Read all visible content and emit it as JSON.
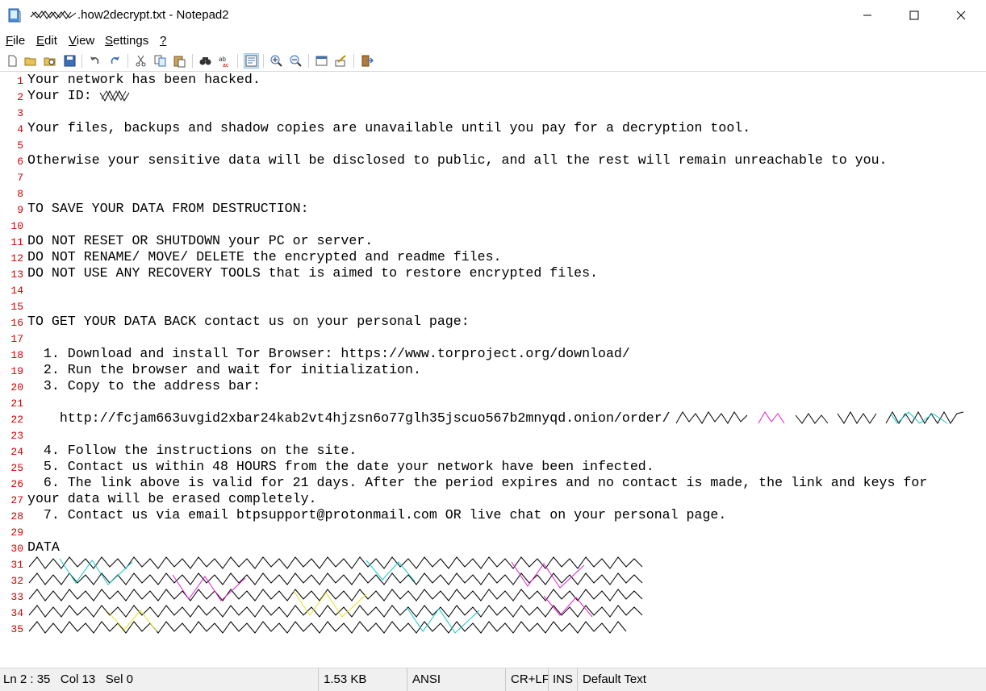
{
  "window": {
    "title": ".how2decrypt.txt - Notepad2",
    "minimize_label": "─",
    "maximize_label": "☐",
    "close_label": "✕"
  },
  "menu": [
    {
      "label": "File",
      "accel": "F",
      "rest": "ile"
    },
    {
      "label": "Edit",
      "accel": "E",
      "rest": "dit"
    },
    {
      "label": "View",
      "accel": "V",
      "rest": "iew"
    },
    {
      "label": "Settings",
      "accel": "S",
      "rest": "ettings"
    },
    {
      "label": "?",
      "accel": "?",
      "rest": ""
    }
  ],
  "toolbar": {
    "icons": [
      "new-file-icon",
      "open-folder-icon",
      "browse-icon",
      "save-icon",
      "undo-icon",
      "redo-icon",
      "cut-icon",
      "copy-icon",
      "paste-icon",
      "find-icon",
      "replace-icon",
      "word-wrap-icon",
      "zoom-in-icon",
      "zoom-out-icon",
      "select-scheme-icon",
      "customize-scheme-icon",
      "exit-icon"
    ],
    "pressed": "word-wrap-icon"
  },
  "document": {
    "line_numbers": [
      "1",
      "2",
      "3",
      "4",
      "5",
      "6",
      "7",
      "8",
      "9",
      "10",
      "11",
      "12",
      "13",
      "14",
      "15",
      "16",
      "17",
      "18",
      "19",
      "20",
      "21",
      "22",
      "23",
      "24",
      "25",
      "26",
      "27",
      "28",
      "29",
      "30",
      "31",
      "32",
      "33",
      "34",
      "35"
    ],
    "lines": [
      "Your network has been hacked.",
      "Your ID: ",
      "",
      "Your files, backups and shadow copies are unavailable until you pay for a decryption tool.",
      "",
      "Otherwise your sensitive data will be disclosed to public, and all the rest will remain unreachable to you.",
      "",
      "",
      "TO SAVE YOUR DATA FROM DESTRUCTION:",
      "",
      "DO NOT RESET OR SHUTDOWN your PC or server.",
      "DO NOT RENAME/ MOVE/ DELETE the encrypted and readme files.",
      "DO NOT USE ANY RECOVERY TOOLS that is aimed to restore encrypted files.",
      "",
      "",
      "TO GET YOUR DATA BACK contact us on your personal page:",
      "",
      "  1. Download and install Tor Browser: https://www.torproject.org/download/",
      "  2. Run the browser and wait for initialization.",
      "  3. Copy to the address bar:",
      "",
      "    http://fcjam663uvgid2xbar24kab2vt4hjzsn6o77glh35jscuo567b2mnyqd.onion/order/",
      "",
      "  4. Follow the instructions on the site.",
      "  5. Contact us within 48 HOURS from the date your network have been infected.",
      "  6. The link above is valid for 21 days. After the period expires and no contact is made, the link and keys for",
      "your data will be erased completely.",
      "  7. Contact us via email btpsupport@protonmail.com OR live chat on your personal page.",
      "",
      "DATA",
      "",
      "",
      "",
      "",
      ""
    ]
  },
  "statusbar": {
    "position": "Ln 2 : 35   Col 13   Sel 0",
    "size": "1.53 KB",
    "encoding": "ANSI",
    "line_endings": "CR+LF",
    "ins": "INS",
    "scheme": "Default Text"
  }
}
